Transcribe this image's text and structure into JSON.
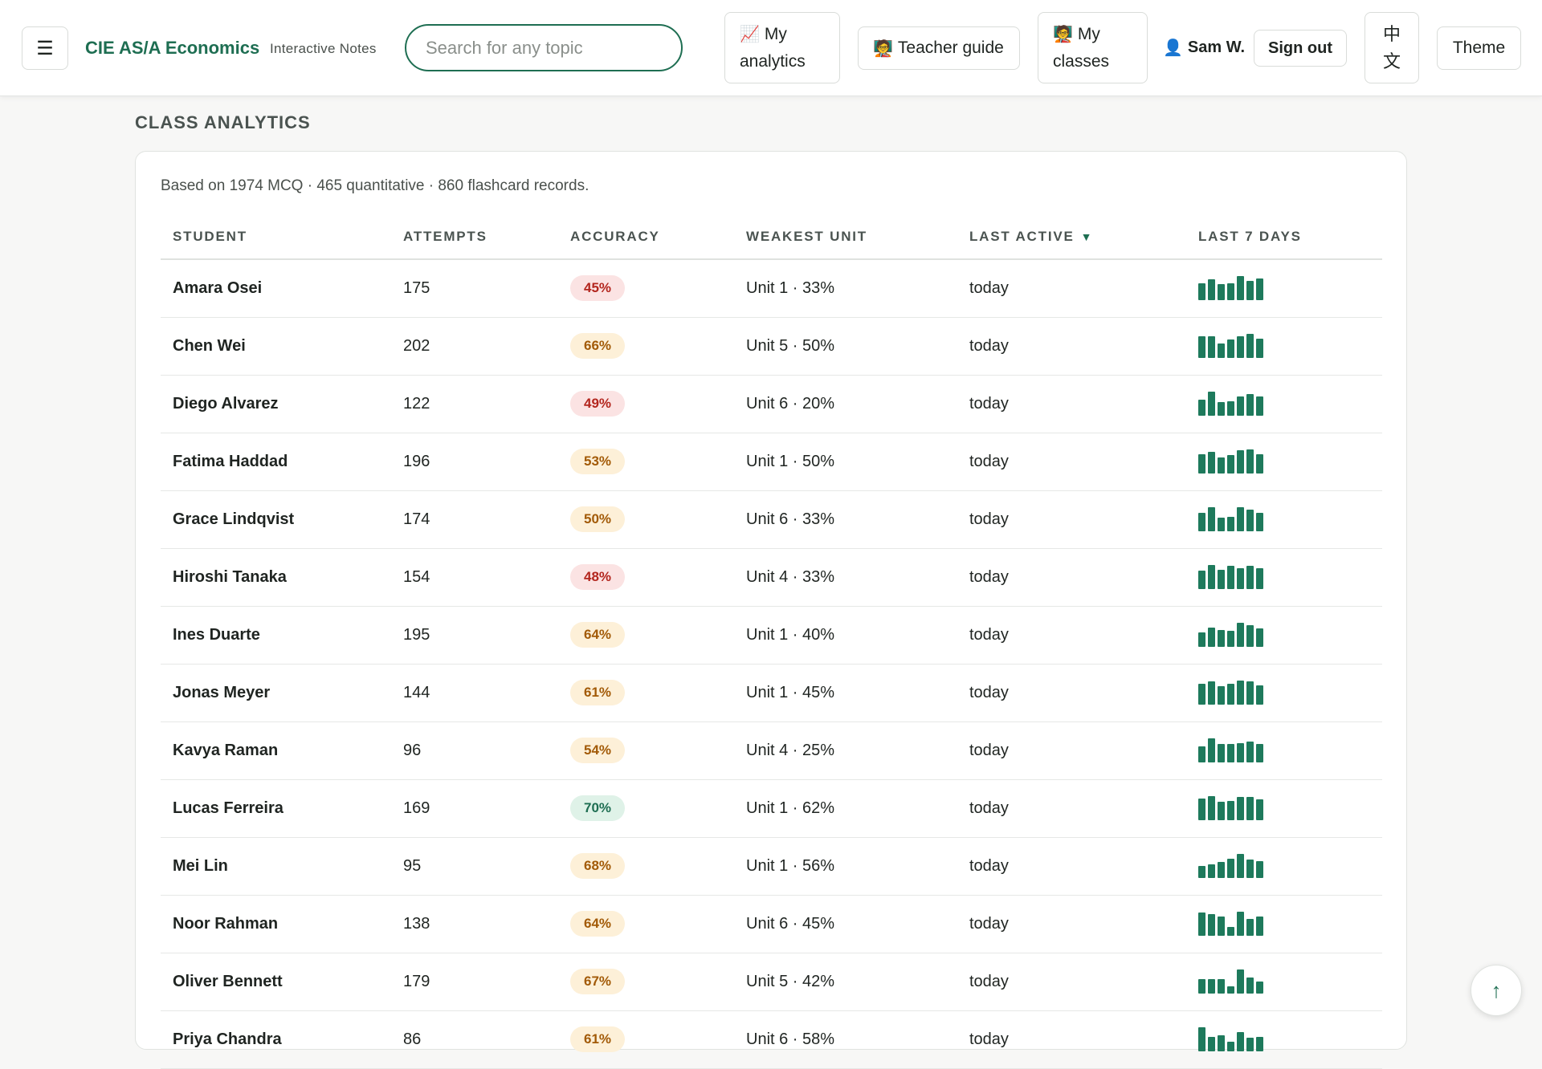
{
  "header": {
    "menu_icon": "☰",
    "brand_title": "CIE AS/A Economics",
    "brand_subtitle": "Interactive Notes",
    "search_placeholder": "Search for any topic",
    "my_analytics_emoji": "📈",
    "my_analytics_line1": "My",
    "my_analytics_line2": "analytics",
    "teacher_guide_emoji": "🧑‍🏫",
    "teacher_guide_label": "Teacher guide",
    "my_classes_emoji": "🧑‍🏫",
    "my_classes_line1": "My",
    "my_classes_line2": "classes",
    "user_emoji": "👤",
    "user_name": "Sam W.",
    "sign_out_label": "Sign out",
    "lang_line1": "中",
    "lang_line2": "文",
    "theme_label": "Theme"
  },
  "page": {
    "section_title": "CLASS ANALYTICS",
    "summary": "Based on 1974 MCQ · 465 quantitative · 860 flashcard records.",
    "scroll_top_icon": "↑"
  },
  "table": {
    "headers": {
      "student": "STUDENT",
      "attempts": "ATTEMPTS",
      "accuracy": "ACCURACY",
      "weakest_unit": "WEAKEST UNIT",
      "last_active": "LAST ACTIVE",
      "last_active_sort": "▼",
      "last_7_days": "LAST 7 DAYS"
    },
    "rows": [
      {
        "name": "Amara Osei",
        "attempts": "175",
        "accuracy": "45%",
        "accuracy_level": "red",
        "weakest": "Unit 1 · 33%",
        "last_active": "today",
        "spark": [
          0.7,
          0.85,
          0.65,
          0.7,
          1.0,
          0.8,
          0.9
        ]
      },
      {
        "name": "Chen Wei",
        "attempts": "202",
        "accuracy": "66%",
        "accuracy_level": "amber",
        "weakest": "Unit 5 · 50%",
        "last_active": "today",
        "spark": [
          0.9,
          0.9,
          0.6,
          0.75,
          0.9,
          1.0,
          0.8
        ]
      },
      {
        "name": "Diego Alvarez",
        "attempts": "122",
        "accuracy": "49%",
        "accuracy_level": "red",
        "weakest": "Unit 6 · 20%",
        "last_active": "today",
        "spark": [
          0.65,
          1.0,
          0.55,
          0.6,
          0.8,
          0.9,
          0.8
        ]
      },
      {
        "name": "Fatima Haddad",
        "attempts": "196",
        "accuracy": "53%",
        "accuracy_level": "amber",
        "weakest": "Unit 1 · 50%",
        "last_active": "today",
        "spark": [
          0.8,
          0.9,
          0.65,
          0.75,
          0.95,
          1.0,
          0.8
        ]
      },
      {
        "name": "Grace Lindqvist",
        "attempts": "174",
        "accuracy": "50%",
        "accuracy_level": "amber",
        "weakest": "Unit 6 · 33%",
        "last_active": "today",
        "spark": [
          0.75,
          1.0,
          0.55,
          0.6,
          1.0,
          0.9,
          0.75
        ]
      },
      {
        "name": "Hiroshi Tanaka",
        "attempts": "154",
        "accuracy": "48%",
        "accuracy_level": "red",
        "weakest": "Unit 4 · 33%",
        "last_active": "today",
        "spark": [
          0.75,
          1.0,
          0.8,
          0.95,
          0.85,
          0.95,
          0.85
        ]
      },
      {
        "name": "Ines Duarte",
        "attempts": "195",
        "accuracy": "64%",
        "accuracy_level": "amber",
        "weakest": "Unit 1 · 40%",
        "last_active": "today",
        "spark": [
          0.6,
          0.8,
          0.7,
          0.65,
          1.0,
          0.9,
          0.75
        ]
      },
      {
        "name": "Jonas Meyer",
        "attempts": "144",
        "accuracy": "61%",
        "accuracy_level": "amber",
        "weakest": "Unit 1 · 45%",
        "last_active": "today",
        "spark": [
          0.85,
          0.95,
          0.75,
          0.85,
          1.0,
          0.95,
          0.8
        ]
      },
      {
        "name": "Kavya Raman",
        "attempts": "96",
        "accuracy": "54%",
        "accuracy_level": "amber",
        "weakest": "Unit 4 · 25%",
        "last_active": "today",
        "spark": [
          0.65,
          1.0,
          0.75,
          0.75,
          0.8,
          0.85,
          0.75
        ]
      },
      {
        "name": "Lucas Ferreira",
        "attempts": "169",
        "accuracy": "70%",
        "accuracy_level": "green",
        "weakest": "Unit 1 · 62%",
        "last_active": "today",
        "spark": [
          0.9,
          1.0,
          0.75,
          0.8,
          0.95,
          0.95,
          0.85
        ]
      },
      {
        "name": "Mei Lin",
        "attempts": "95",
        "accuracy": "68%",
        "accuracy_level": "amber",
        "weakest": "Unit 1 · 56%",
        "last_active": "today",
        "spark": [
          0.5,
          0.55,
          0.65,
          0.8,
          1.0,
          0.75,
          0.7
        ]
      },
      {
        "name": "Noor Rahman",
        "attempts": "138",
        "accuracy": "64%",
        "accuracy_level": "amber",
        "weakest": "Unit 6 · 45%",
        "last_active": "today",
        "spark": [
          0.95,
          0.9,
          0.8,
          0.35,
          1.0,
          0.7,
          0.8
        ]
      },
      {
        "name": "Oliver Bennett",
        "attempts": "179",
        "accuracy": "67%",
        "accuracy_level": "amber",
        "weakest": "Unit 5 · 42%",
        "last_active": "today",
        "spark": [
          0.6,
          0.6,
          0.6,
          0.3,
          1.0,
          0.65,
          0.5
        ]
      },
      {
        "name": "Priya Chandra",
        "attempts": "86",
        "accuracy": "61%",
        "accuracy_level": "amber",
        "weakest": "Unit 6 · 58%",
        "last_active": "today",
        "spark": [
          1.0,
          0.6,
          0.65,
          0.4,
          0.8,
          0.55,
          0.6
        ]
      }
    ]
  },
  "colors": {
    "brand": "#1e6e52",
    "spark": "#1e7a5c",
    "badge_red_bg": "#fbe3e3",
    "badge_amber_bg": "#fdf0d8",
    "badge_green_bg": "#dff2e8"
  }
}
